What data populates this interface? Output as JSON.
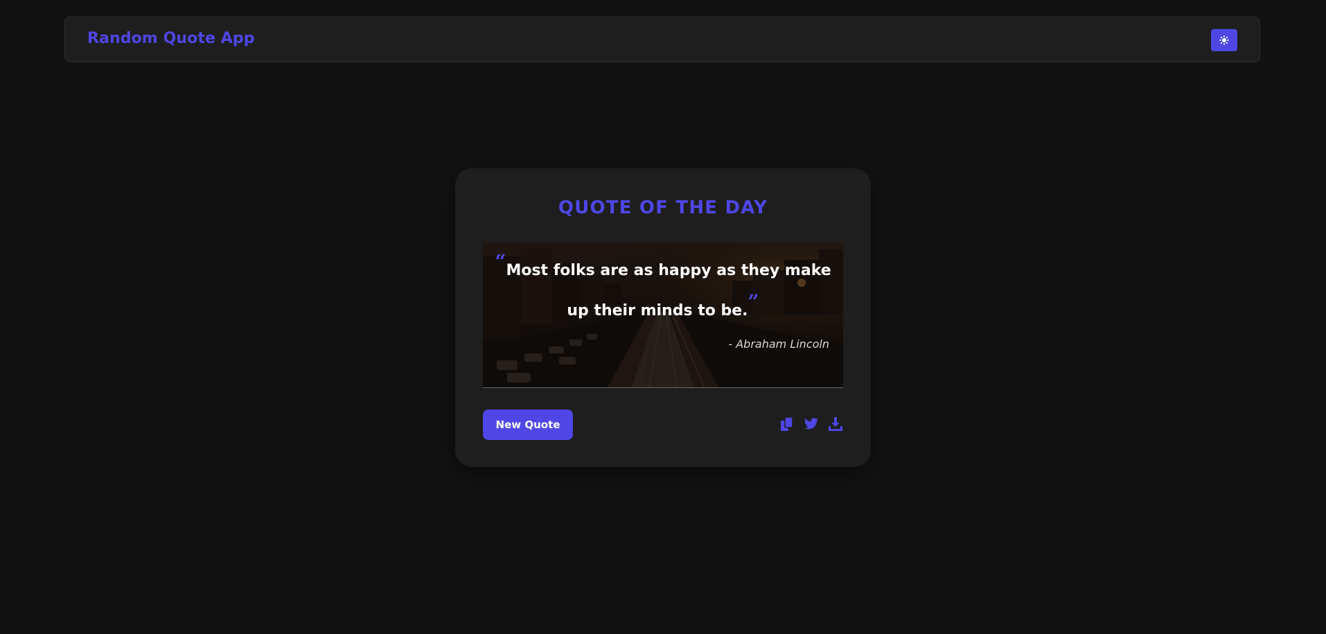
{
  "header": {
    "title": "Random Quote App",
    "theme_toggle_icon": "sun-icon"
  },
  "card": {
    "heading": "QUOTE OF THE DAY",
    "quote": {
      "open_mark": "“",
      "text": "Most folks are as happy as they make up their minds to be.",
      "close_mark": "”",
      "author": "- Abraham Lincoln",
      "background_image": "city-street-sunset-photo"
    },
    "new_quote_label": "New Quote",
    "actions": [
      {
        "icon": "copy-icon"
      },
      {
        "icon": "twitter-icon"
      },
      {
        "icon": "download-icon"
      }
    ]
  },
  "colors": {
    "accent": "#4f46e5",
    "page_background": "#121212",
    "surface": "#1e1e1e"
  }
}
